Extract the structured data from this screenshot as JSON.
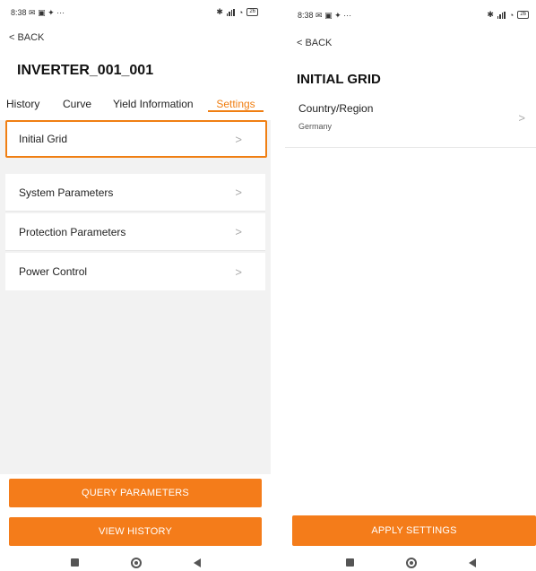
{
  "status_bar": {
    "time": "8:38",
    "notification_icons": "···",
    "battery": "26"
  },
  "left": {
    "back_label": "BACK",
    "title": "INVERTER_001_001",
    "tabs": [
      {
        "label": "History"
      },
      {
        "label": "Curve"
      },
      {
        "label": "Yield Information"
      },
      {
        "label": "Settings",
        "active": true
      }
    ],
    "menu": [
      {
        "label": "Initial Grid",
        "highlighted": true
      },
      {
        "label": "System Parameters"
      },
      {
        "label": "Protection Parameters"
      },
      {
        "label": "Power Control"
      }
    ],
    "buttons": {
      "query": "QUERY PARAMETERS",
      "history": "VIEW HISTORY"
    }
  },
  "right": {
    "back_label": "BACK",
    "title": "INITIAL GRID",
    "field": {
      "label": "Country/Region",
      "value": "Germany"
    },
    "apply_button": "APPLY SETTINGS"
  },
  "colors": {
    "accent": "#f07f13",
    "button": "#f47c1a",
    "content_bg": "#f2f2f2"
  }
}
